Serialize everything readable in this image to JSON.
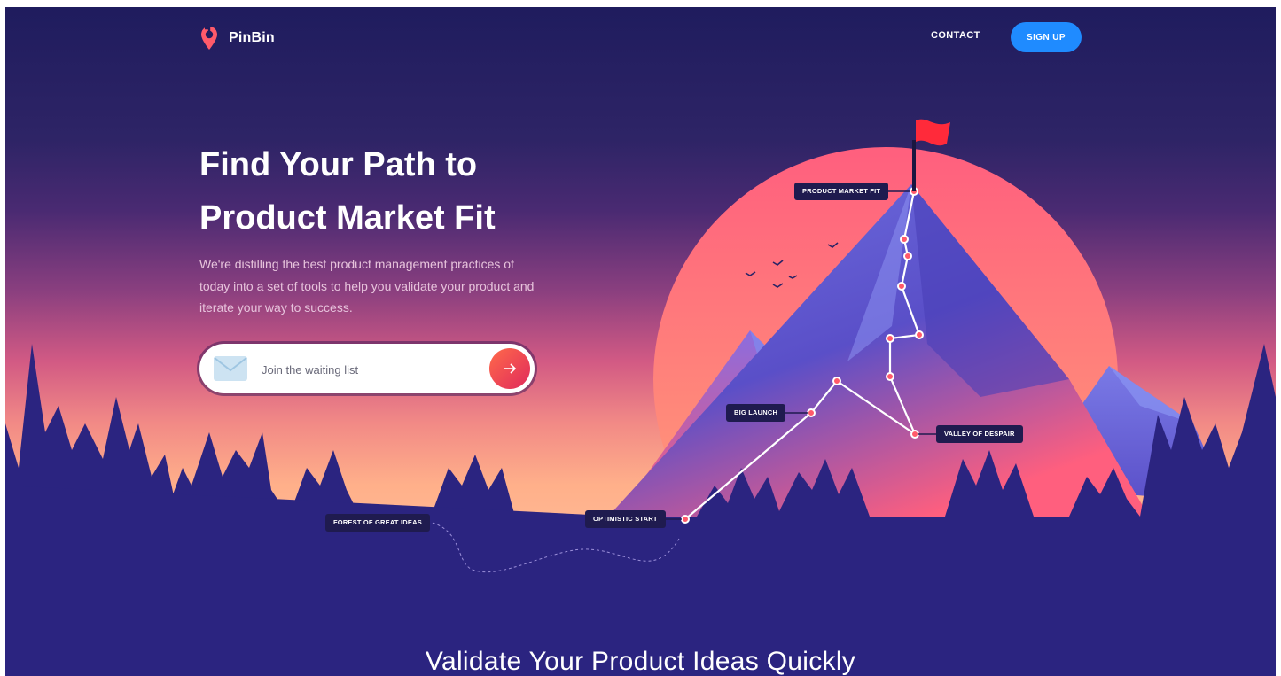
{
  "brand": {
    "name": "PinBin"
  },
  "nav": {
    "contact": "CONTACT",
    "signup": "SIGN UP"
  },
  "hero": {
    "title_line1": "Find Your Path to",
    "title_line2": "Product Market Fit",
    "description": "We're distilling the best product management practices of today into a set of tools to help you validate your product and iterate your way to success.",
    "email_placeholder": "Join the waiting list"
  },
  "map_labels": {
    "product_market_fit": "PRODUCT MARKET FIT",
    "big_launch": "BIG LAUNCH",
    "valley_of_despair": "VALLEY OF DESPAIR",
    "optimistic_start": "OPTIMISTIC START",
    "forest_of_great_ideas": "FOREST OF GREAT IDEAS"
  },
  "section": {
    "title": "Validate Your Product Ideas Quickly"
  },
  "colors": {
    "background": "#2b2480",
    "signup_button": "#1f8bff",
    "accent": "#ff4a5a",
    "label_bg": "#1f1b4f"
  },
  "icons": [
    "pin-logo-icon",
    "mail-icon",
    "arrow-right-icon",
    "flag-icon"
  ]
}
